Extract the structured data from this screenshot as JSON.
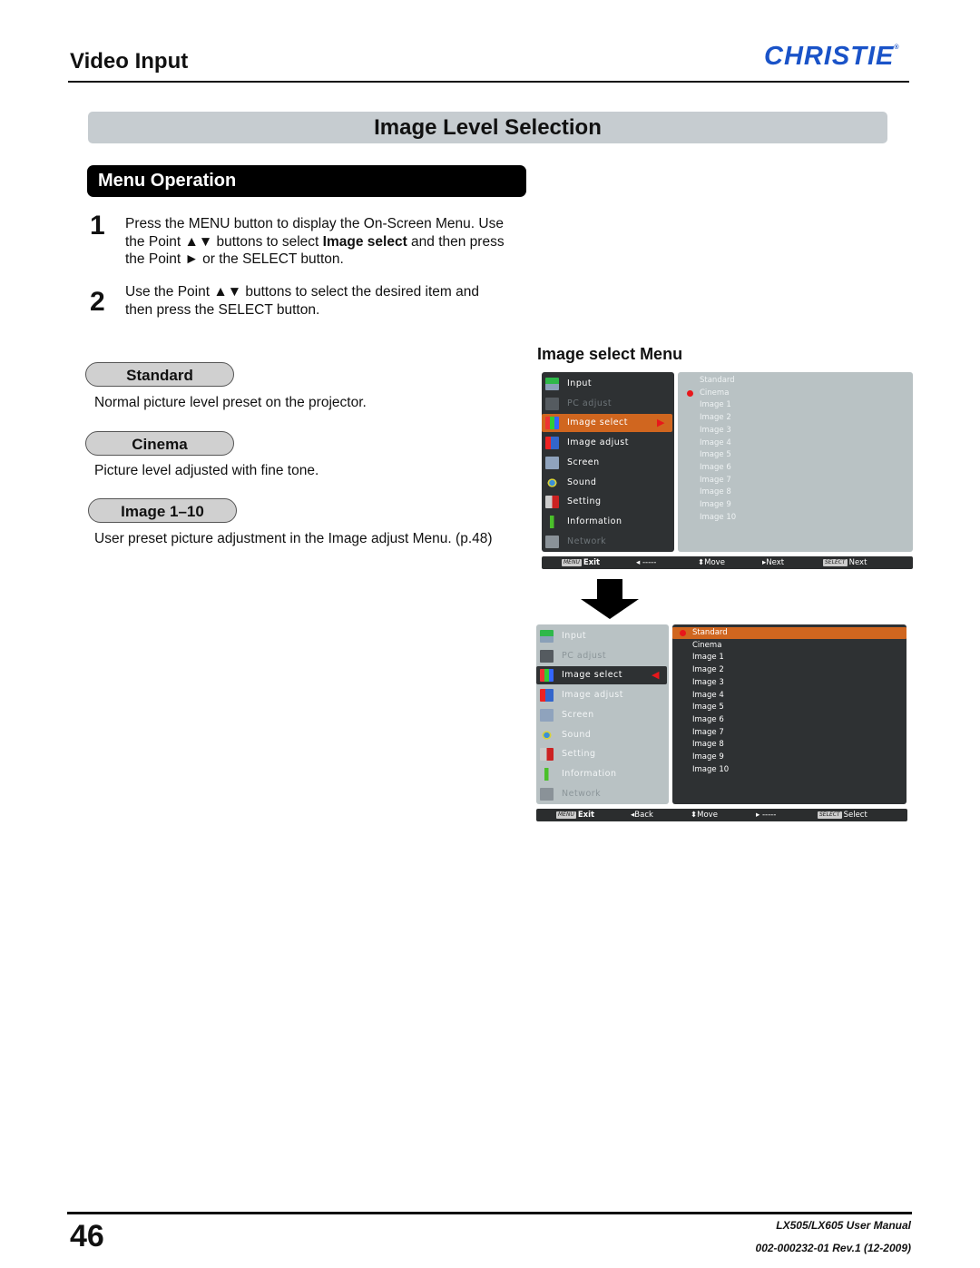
{
  "header": {
    "section_title": "Video Input",
    "logo_text": "CHRISTIE",
    "logo_mark": "®"
  },
  "banner": {
    "title": "Image Level Selection"
  },
  "menu_operation": {
    "heading": "Menu Operation",
    "steps": [
      {
        "number": "1",
        "lines": [
          "Press the MENU button to display the On-Screen Menu. Use",
          "the Point ▲▼ buttons to select ",
          "Image select",
          " and then press",
          "the Point ► or the SELECT button."
        ]
      },
      {
        "number": "2",
        "lines": [
          "Use the Point ▲▼ buttons to select the desired item and",
          "then press the SELECT button."
        ]
      }
    ]
  },
  "options": [
    {
      "label": "Standard",
      "description": "Normal picture level preset on the projector."
    },
    {
      "label": "Cinema",
      "description": "Picture level adjusted with fine tone."
    },
    {
      "label": "Image 1–10",
      "description": "User preset picture adjustment in the Image adjust Menu. (p.48)"
    }
  ],
  "image_select_menu": {
    "title": "Image select Menu",
    "colors": {
      "accent": "#d0661f",
      "dark_panel": "#2e3133",
      "light_panel": "#b9c2c4",
      "bullet": "#e8171b"
    },
    "main_menu": [
      {
        "label": "Input",
        "icon": "input-icon"
      },
      {
        "label": "PC adjust",
        "icon": "pc-adjust-icon"
      },
      {
        "label": "Image select",
        "icon": "image-select-icon"
      },
      {
        "label": "Image adjust",
        "icon": "image-adjust-icon"
      },
      {
        "label": "Screen",
        "icon": "screen-icon"
      },
      {
        "label": "Sound",
        "icon": "sound-icon"
      },
      {
        "label": "Setting",
        "icon": "setting-icon"
      },
      {
        "label": "Information",
        "icon": "information-icon"
      },
      {
        "label": "Network",
        "icon": "network-icon"
      }
    ],
    "sub_items": [
      "Standard",
      "Cinema",
      "Image 1",
      "Image 2",
      "Image 3",
      "Image 4",
      "Image 5",
      "Image 6",
      "Image 7",
      "Image 8",
      "Image 9",
      "Image 10"
    ],
    "screen1": {
      "selected_main": "Image select",
      "current_item": "Cinema",
      "footer": {
        "menu_key": "MENU",
        "exit": "Exit",
        "left": "-----",
        "move": "Move",
        "right": "Next",
        "select_key": "SELECT",
        "select": "Next"
      }
    },
    "screen2": {
      "selected_main": "Image select",
      "current_item": "Standard",
      "highlighted_item": "Standard",
      "footer": {
        "menu_key": "MENU",
        "exit": "Exit",
        "left": "Back",
        "move": "Move",
        "right": "-----",
        "select_key": "SELECT",
        "select": "Select"
      }
    }
  },
  "footer": {
    "page_number": "46",
    "manual": "LX505/LX605 User Manual",
    "revision": "002-000232-01 Rev.1 (12-2009)"
  }
}
